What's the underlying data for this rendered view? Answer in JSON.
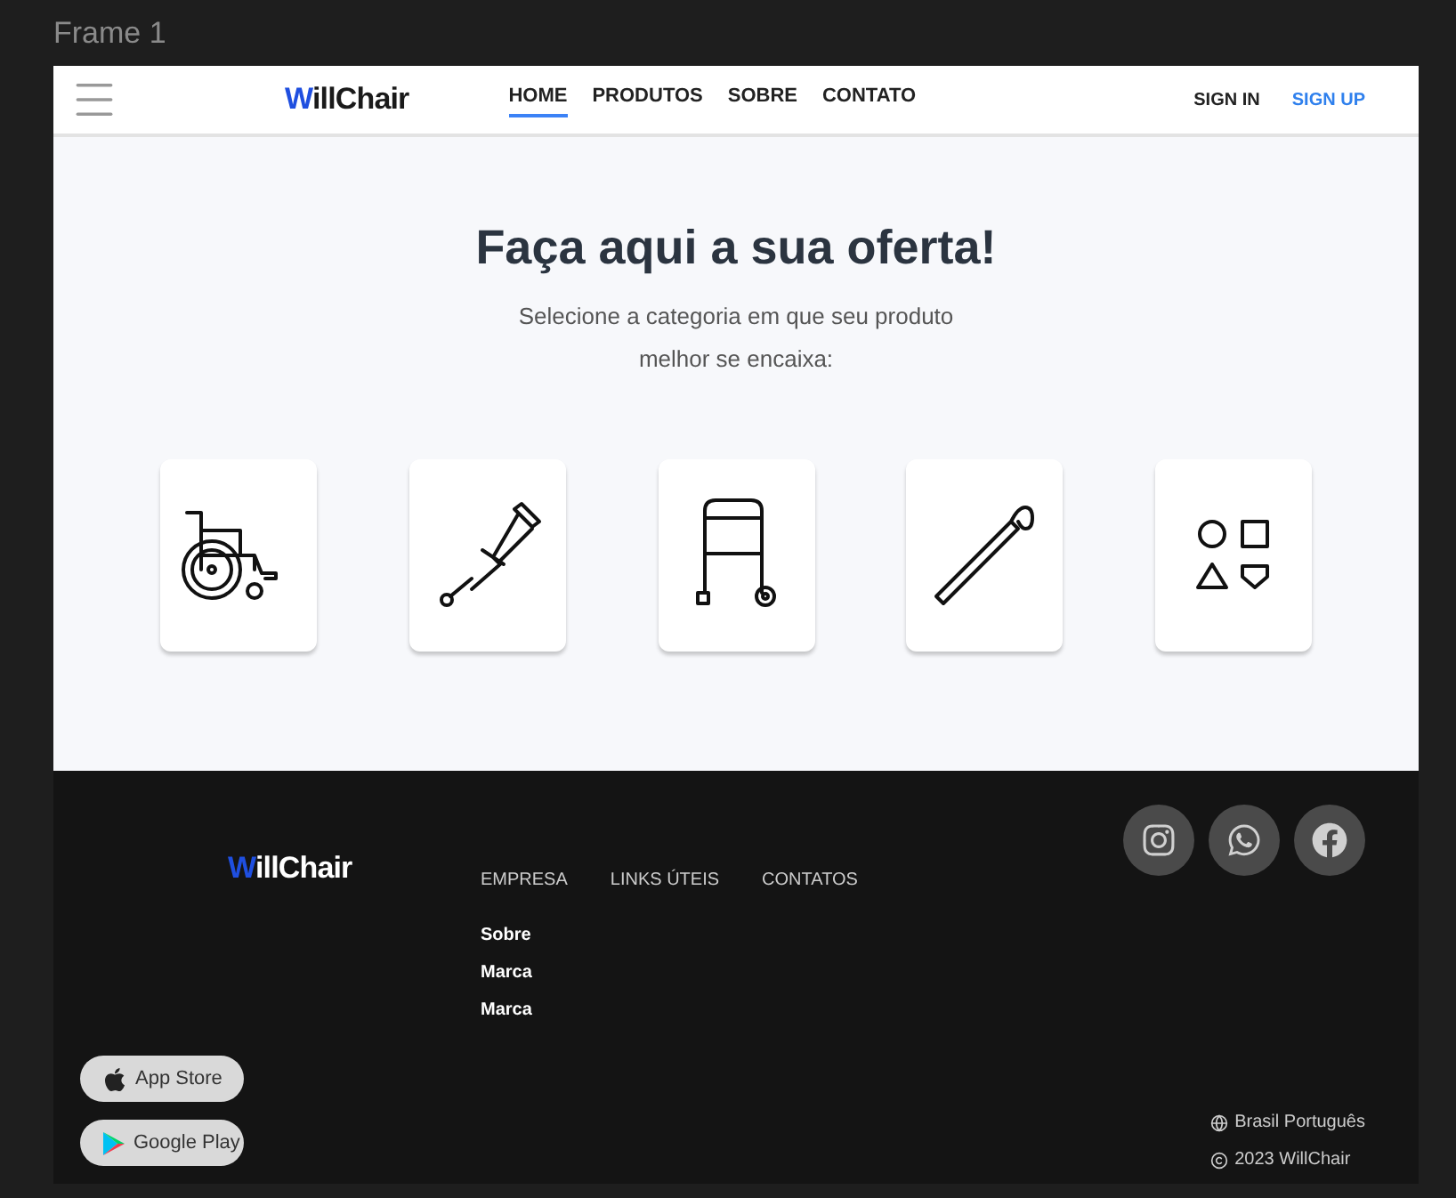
{
  "canvas": {
    "frame_label": "Frame 1"
  },
  "header": {
    "logo": {
      "accent": "W",
      "rest": "illChair"
    },
    "nav": [
      {
        "label": "HOME",
        "selected": true
      },
      {
        "label": "PRODUTOS",
        "selected": false
      },
      {
        "label": "SOBRE",
        "selected": false
      },
      {
        "label": "CONTATO",
        "selected": false
      }
    ],
    "sign_in": "SIGN IN",
    "sign_up": "SIGN UP"
  },
  "hero": {
    "title": "Faça aqui a sua oferta!",
    "subtitle": "Selecione a categoria em que seu produto melhor se encaixa:"
  },
  "categories": [
    {
      "kind": "wheelchair"
    },
    {
      "kind": "crutch"
    },
    {
      "kind": "walker"
    },
    {
      "kind": "cane"
    },
    {
      "kind": "other"
    }
  ],
  "footer": {
    "logo": {
      "accent": "W",
      "rest": "illChair"
    },
    "columns": [
      {
        "title": "EMPRESA",
        "links": [
          "Sobre",
          "Marca",
          "Marca"
        ]
      },
      {
        "title": "LINKS ÚTEIS"
      },
      {
        "title": "CONTATOS"
      }
    ],
    "social": [
      {
        "kind": "instagram"
      },
      {
        "kind": "whatsapp"
      },
      {
        "kind": "facebook"
      }
    ],
    "stores": [
      {
        "kind": "apple",
        "label": "App Store"
      },
      {
        "kind": "google",
        "label": "Google Play"
      }
    ],
    "language": "Brasil Português",
    "copyright": "2023 WillChair"
  }
}
